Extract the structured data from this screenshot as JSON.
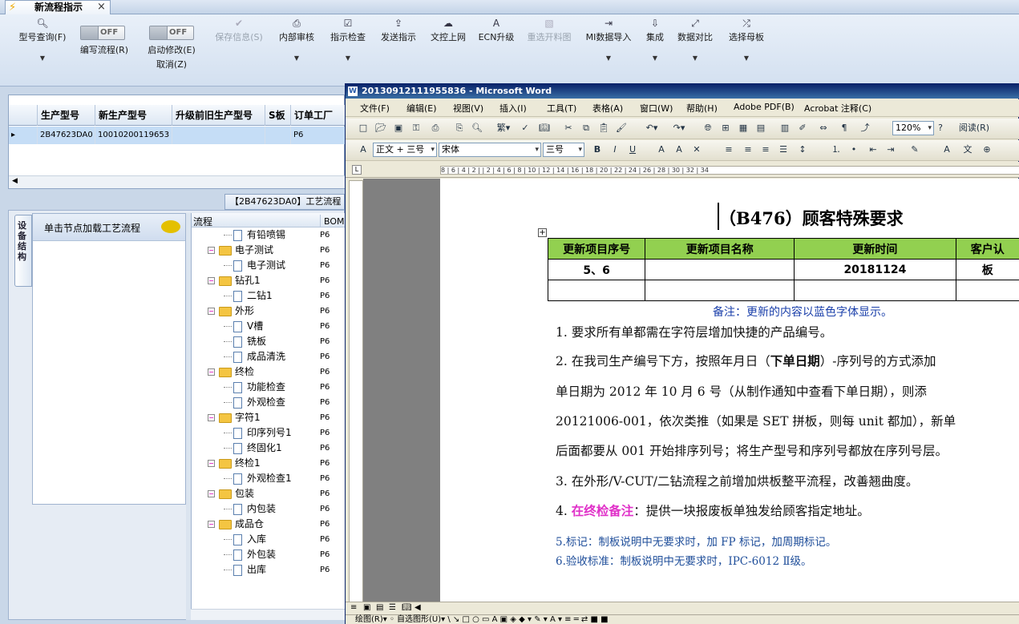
{
  "tab": {
    "title": "新流程指示",
    "close": "×"
  },
  "ribbon": {
    "buttons": [
      {
        "label": "型号查询(F)",
        "icon": "search-icon"
      },
      {
        "label": "编写流程(R)",
        "toggle": "OFF"
      },
      {
        "label": "启动修改(E)",
        "sub": "取消(Z)",
        "toggle": "OFF"
      },
      {
        "label": "保存信息(S)",
        "icon": "save-icon",
        "disabled": true
      },
      {
        "label": "内部审核",
        "icon": "printer-icon"
      },
      {
        "label": "指示检查",
        "icon": "check-icon"
      },
      {
        "label": "发送指示",
        "icon": "send-icon"
      },
      {
        "label": "文控上网",
        "icon": "cloud-upload-icon"
      },
      {
        "label": "ECN升级",
        "icon": "font-icon"
      },
      {
        "label": "重选开料图",
        "icon": "image-icon",
        "disabled": true
      },
      {
        "label": "MI数据导入",
        "icon": "import-icon"
      },
      {
        "label": "集成",
        "icon": "download-icon"
      },
      {
        "label": "数据对比",
        "icon": "compare-icon"
      },
      {
        "label": "选择母板",
        "icon": "shuffle-icon"
      }
    ]
  },
  "grid": {
    "headers": [
      "生产型号",
      "新生产型号",
      "升级前旧生产型号",
      "S板",
      "订单工厂"
    ],
    "row": [
      "2B47623DA0",
      "10010200119653",
      "",
      "",
      "P6"
    ]
  },
  "process": {
    "tab_title": "【2B47623DA0】工艺流程",
    "side_tab": "设备结构",
    "node_hint": "单击节点加载工艺流程",
    "tree_header": "流程",
    "bom_header": "BOM工",
    "nodes": [
      {
        "label": "有铅喷锡",
        "type": "doc",
        "bom": "P6"
      },
      {
        "label": "电子测试",
        "type": "folder",
        "bom": "P6"
      },
      {
        "label": "电子测试",
        "type": "doc",
        "bom": "P6"
      },
      {
        "label": "钻孔1",
        "type": "folder",
        "bom": "P6"
      },
      {
        "label": "二钻1",
        "type": "doc",
        "bom": "P6"
      },
      {
        "label": "外形",
        "type": "folder",
        "bom": "P6"
      },
      {
        "label": "V槽",
        "type": "doc",
        "bom": "P6"
      },
      {
        "label": "铣板",
        "type": "doc",
        "bom": "P6"
      },
      {
        "label": "成品清洗",
        "type": "doc",
        "bom": "P6"
      },
      {
        "label": "终检",
        "type": "folder",
        "bom": "P6"
      },
      {
        "label": "功能检查",
        "type": "doc",
        "bom": "P6"
      },
      {
        "label": "外观检查",
        "type": "doc",
        "bom": "P6"
      },
      {
        "label": "字符1",
        "type": "folder",
        "bom": "P6"
      },
      {
        "label": "印序列号1",
        "type": "doc",
        "bom": "P6"
      },
      {
        "label": "终固化1",
        "type": "doc",
        "bom": "P6"
      },
      {
        "label": "终检1",
        "type": "folder",
        "bom": "P6"
      },
      {
        "label": "外观检查1",
        "type": "doc",
        "bom": "P6"
      },
      {
        "label": "包装",
        "type": "folder",
        "bom": "P6"
      },
      {
        "label": "内包装",
        "type": "doc",
        "bom": "P6"
      },
      {
        "label": "成品仓",
        "type": "folder",
        "bom": "P6"
      },
      {
        "label": "入库",
        "type": "doc",
        "bom": "P6"
      },
      {
        "label": "外包装",
        "type": "doc",
        "bom": "P6"
      },
      {
        "label": "出库",
        "type": "doc",
        "bom": "P6"
      }
    ]
  },
  "word": {
    "title": "20130912111955836 - Microsoft Word",
    "menu": [
      "文件(F)",
      "编辑(E)",
      "视图(V)",
      "插入(I)",
      "工具(T)",
      "表格(A)",
      "窗口(W)",
      "帮助(H)",
      "Adobe PDF(B)",
      "Acrobat 注释(C)"
    ],
    "zoom": "120%",
    "reading": "阅读(R)",
    "style": "正文 + 三号",
    "font": "宋体",
    "size": "三号",
    "ruler": "8 | 6 | 4 | 2 |   | 2 | 4 | 6 | 8 | 10 | 12 | 14 | 16 | 18 | 20 | 22 | 24 | 26 | 28 | 30 | 32 | 34",
    "doc": {
      "heading": "（B476）顾客特殊要求",
      "table_headers": [
        "更新项目序号",
        "更新项目名称",
        "更新时间",
        "客户认"
      ],
      "table_row": [
        "5、6",
        "",
        "20181124",
        "板"
      ],
      "note": "备注：更新的内容以蓝色字体显示。",
      "p1": "1. 要求所有单都需在字符层增加快捷的产品编号。",
      "p2a": "2. 在我司生产编号下方，按照年月日（",
      "p2b": "下单日期",
      "p2c": "）-序列号的方式添加",
      "p2d": "单日期为 2012 年 10 月 6 号（从制作通知中查看下单日期），则添",
      "p2e": "20121006-001，依次类推（如果是 SET 拼板，则每 unit 都加），新单",
      "p2f": "后面都要从 001 开始排序列号；将生产型号和序列号都放在序列号层。",
      "p3": "3. 在外形/V-CUT/二钻流程之前增加烘板整平流程，改善翘曲度。",
      "p4a": "4. ",
      "p4b": "在终检备注",
      "p4c": "：提供一块报废板单独发给顾客指定地址。",
      "p5": "5.标记：制板说明中无要求时，加 FP 标记，加周期标记。",
      "p6": "6.验收标准：制板说明中无要求时，IPC-6012 Ⅱ级。"
    },
    "drawbar": "绘图(R)▾  ◦  自选图形(U)▾  \\  ↘  □  ○  ▭  A  ▣  ◈  ◆ ▾  ✎ ▾  A ▾  ≡  ═  ⇄  ■  ■"
  },
  "colors": {
    "ribbon": "#d3e0f0",
    "table_header": "#92d050",
    "note_blue": "#1a3faa",
    "magenta": "#e030c8"
  }
}
